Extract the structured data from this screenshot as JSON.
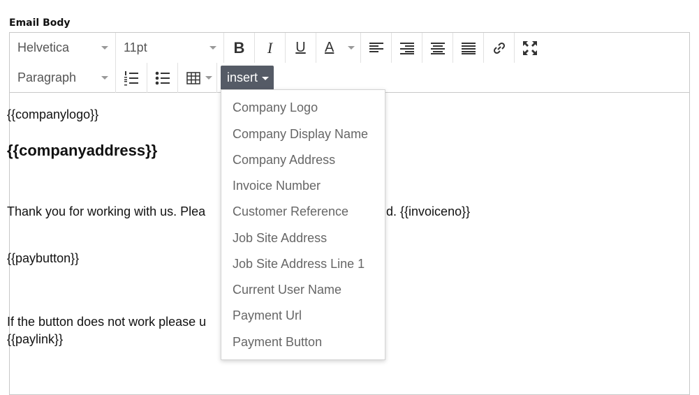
{
  "field_label": "Email Body",
  "toolbar": {
    "font_family": "Helvetica",
    "font_size": "11pt",
    "block_format": "Paragraph",
    "insert_label": "insert",
    "buttons": {
      "bold": "B",
      "italic": "I",
      "underline": "U",
      "text_color": "A"
    }
  },
  "content": {
    "line1": "{{companylogo}}",
    "line2": "{{companyaddress}}",
    "line3_start": "Thank you for working with us. Plea",
    "line3_end": "d. {{invoiceno}}",
    "line4": "{{paybutton}}",
    "line5_start": "If the button does not work please u",
    "line6": "{{paylink}}"
  },
  "insert_menu": {
    "items": [
      "Company Logo",
      "Company Display Name",
      "Company Address",
      "Invoice Number",
      "Customer Reference",
      "Job Site Address",
      "Job Site Address Line 1",
      "Current User Name",
      "Payment Url",
      "Payment Button"
    ]
  },
  "colors": {
    "insert_bg": "#555b66",
    "border": "#c8c8c8",
    "menu_text": "#666666"
  }
}
